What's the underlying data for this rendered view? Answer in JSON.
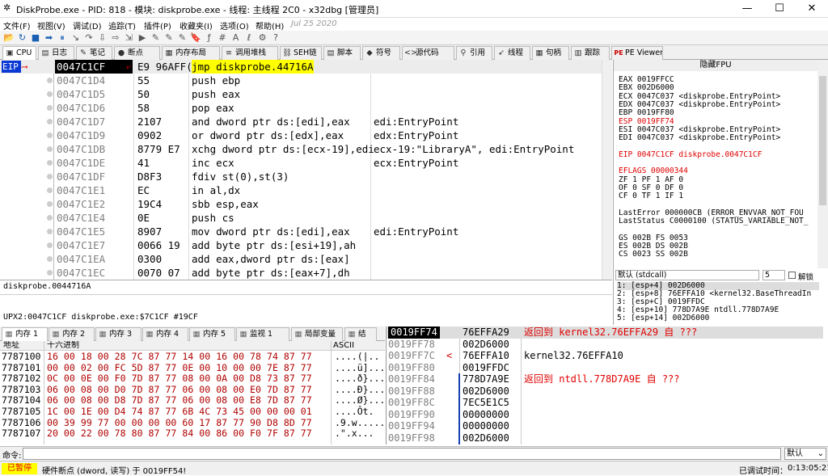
{
  "window": {
    "title": "DiskProbe.exe - PID: 818 - 模块: diskprobe.exe - 线程: 主线程 2C0 - x32dbg [管理员]",
    "minimize": "—",
    "maximize": "☐",
    "close": "✕"
  },
  "menu": [
    "文件(F)",
    "视图(V)",
    "调试(D)",
    "追踪(T)",
    "插件(P)",
    "收藏夹(I)",
    "选项(O)",
    "帮助(H)",
    "Jul 25 2020"
  ],
  "toolbar_icons": [
    "open-icon",
    "restart-icon",
    "close-icon",
    "run-icon",
    "pause-icon",
    "step-into-icon",
    "step-over-icon",
    "trace-into-icon",
    "trace-over-icon",
    "run-to-user-icon",
    "animate-icon",
    "highlight-icon",
    "comment-icon",
    "label-icon",
    "bookmark-icon",
    "function-icon",
    "hash-icon",
    "string-icon",
    "module-icon",
    "settings-icon",
    "help-icon"
  ],
  "toolbar_glyphs": [
    "📂",
    "↻",
    "■",
    "➡",
    "⏸",
    "↘",
    "↷",
    "⇩",
    "⇨",
    "⇲",
    "▶",
    "✎",
    "✎",
    "✎",
    "🔖",
    "ƒ",
    "#",
    "A",
    "ℓ",
    "⚙",
    "?"
  ],
  "tabs": [
    {
      "label": "CPU",
      "icon": "▣"
    },
    {
      "label": "日志",
      "icon": "▤"
    },
    {
      "label": "笔记",
      "icon": "✎"
    },
    {
      "label": "断点",
      "icon": "●"
    },
    {
      "label": "内存布局",
      "icon": "▦"
    },
    {
      "label": "调用堆栈",
      "icon": "≡"
    },
    {
      "label": "SEH链",
      "icon": "⛓"
    },
    {
      "label": "脚本",
      "icon": "▤"
    },
    {
      "label": "符号",
      "icon": "◆"
    },
    {
      "label": "源代码",
      "icon": "<>"
    },
    {
      "label": "引用",
      "icon": "⚲"
    },
    {
      "label": "线程",
      "icon": "➶"
    },
    {
      "label": "句柄",
      "icon": "▦"
    },
    {
      "label": "跟踪",
      "icon": "▥"
    },
    {
      "label": "PE Viewer",
      "icon": "PE"
    }
  ],
  "disasm": {
    "eip_label": "EIP",
    "rows": [
      {
        "addr": "0047C1CF",
        "bytes": "E9 96AFF(",
        "instr": "jmp diskprobe.44716A",
        "cmt": ""
      },
      {
        "addr": "0047C1D4",
        "bytes": "55",
        "instr": "push ebp",
        "cmt": ""
      },
      {
        "addr": "0047C1D5",
        "bytes": "50",
        "instr": "push eax",
        "cmt": ""
      },
      {
        "addr": "0047C1D6",
        "bytes": "58",
        "instr": "pop eax",
        "cmt": ""
      },
      {
        "addr": "0047C1D7",
        "bytes": "2107",
        "instr": "and dword ptr ds:[edi],eax",
        "cmt": "edi:EntryPoint"
      },
      {
        "addr": "0047C1D9",
        "bytes": "0902",
        "instr": "or dword ptr ds:[edx],eax",
        "cmt": "edx:EntryPoint"
      },
      {
        "addr": "0047C1DB",
        "bytes": "8779 E7",
        "instr": "xchg dword ptr ds:[ecx-19],edi",
        "cmt": "ecx-19:\"LibraryA\", edi:EntryPoint"
      },
      {
        "addr": "0047C1DE",
        "bytes": "41",
        "instr": "inc ecx",
        "cmt": "ecx:EntryPoint"
      },
      {
        "addr": "0047C1DF",
        "bytes": "D8F3",
        "instr": "fdiv st(0),st(3)",
        "cmt": ""
      },
      {
        "addr": "0047C1E1",
        "bytes": "EC",
        "instr": "in al,dx",
        "cmt": ""
      },
      {
        "addr": "0047C1E2",
        "bytes": "19C4",
        "instr": "sbb esp,eax",
        "cmt": ""
      },
      {
        "addr": "0047C1E4",
        "bytes": "0E",
        "instr": "push cs",
        "cmt": ""
      },
      {
        "addr": "0047C1E5",
        "bytes": "8907",
        "instr": "mov dword ptr ds:[edi],eax",
        "cmt": "edi:EntryPoint"
      },
      {
        "addr": "0047C1E7",
        "bytes": "0066 19",
        "instr": "add byte ptr ds:[esi+19],ah",
        "cmt": ""
      },
      {
        "addr": "0047C1EA",
        "bytes": "0300",
        "instr": "add eax,dword ptr ds:[eax]",
        "cmt": ""
      },
      {
        "addr": "0047C1EC",
        "bytes": "0070 07",
        "instr": "add byte ptr ds:[eax+7],dh",
        "cmt": ""
      }
    ]
  },
  "registers": {
    "header": "隐藏FPU",
    "lines": [
      "EAX    0019FFCC",
      "EBX    002D6000",
      "ECX    0047C037     <diskprobe.EntryPoint>",
      "EDX    0047C037     <diskprobe.EntryPoint>",
      "EBP    0019FF80",
      "ESP    0019FF74",
      "ESI    0047C037     <diskprobe.EntryPoint>",
      "EDI    0047C037     <diskprobe.EntryPoint>",
      "",
      "EIP    0047C1CF     diskprobe.0047C1CF",
      "",
      "EFLAGS   00000344",
      "ZF 1   PF 1   AF 0",
      "OF 0   SF 0   DF 0",
      "CF 0   TF 1   IF 1",
      "",
      "LastError   000000CB (ERROR_ENVVAR_NOT_FOU",
      "LastStatus  C0000100 (STATUS_VARIABLE_NOT_",
      "",
      "GS 002B   FS 0053",
      "ES 002B   DS 002B",
      "CS 0023   SS 002B"
    ],
    "red_lines": [
      5,
      9,
      11
    ]
  },
  "callconv": {
    "label": "默认 (stdcall)",
    "count": "5",
    "unlock": "解锁"
  },
  "stack_args": [
    "1: [esp+4] 002D6000",
    "2: [esp+8] 76EFFA10 <kernel32.BaseThreadIn",
    "3: [esp+C] 0019FFDC",
    "4: [esp+10] 778D7A9E ntdll.778D7A9E",
    "5: [esp+14] 002D6000"
  ],
  "info": {
    "line1": "diskprobe.0044716A",
    "line2": "UPX2:0047C1CF diskprobe.exe:$7C1CF #19CF"
  },
  "memtabs": [
    "内存 1",
    "内存 2",
    "内存 3",
    "内存 4",
    "内存 5",
    "监视 1",
    "局部变量",
    "结"
  ],
  "dump": {
    "col_addr": "地址",
    "col_hex": "十六进制",
    "col_ascii": "ASCII",
    "rows": [
      {
        "addr": "7787100",
        "hex": "16 00 18 00 28 7C 87 77 14 00 16 00 78 74 87 77",
        "ascii": "....(|.."
      },
      {
        "addr": "7787101",
        "hex": "00 00 02 00 FC 5D 87 77 0E 00 10 00 00 7E 87 77",
        "ascii": "....ü]..."
      },
      {
        "addr": "7787102",
        "hex": "0C 00 0E 00 F0 7D 87 77 08 00 0A 00 D8 73 87 77",
        "ascii": "....ð}..."
      },
      {
        "addr": "7787103",
        "hex": "06 00 08 00 D0 7D 87 77 06 00 08 00 E0 7D 87 77",
        "ascii": "....Ð}..."
      },
      {
        "addr": "7787104",
        "hex": "06 00 08 00 D8 7D 87 77 06 00 08 00 E8 7D 87 77",
        "ascii": "....Ø}..."
      },
      {
        "addr": "7787105",
        "hex": "1C 00 1E 00 D4 74 87 77 6B 4C 73 45 00 00 00 01",
        "ascii": "....Ôt."
      },
      {
        "addr": "7787106",
        "hex": "00 39 99 77 00 00 00 00 60 17 87 77 90 D8 8D 77",
        "ascii": ".9.w....."
      },
      {
        "addr": "7787107",
        "hex": "20 00 22 00 78 80 87 77 84 00 86 00 F0 7F 87 77",
        "ascii": " .\".x..."
      }
    ]
  },
  "stack": {
    "rows": [
      {
        "addr": "0019FF74",
        "val": "76EFFA29",
        "cmt": "返回到 kernel32.76EFFA29 自 ???",
        "cmt_red": true
      },
      {
        "addr": "0019FF78",
        "val": "002D6000",
        "cmt": "",
        "cmt_red": false
      },
      {
        "addr": "0019FF7C",
        "val": "76EFFA10",
        "cmt": "kernel32.76EFFA10",
        "cmt_red": false
      },
      {
        "addr": "0019FF80",
        "val": "0019FFDC",
        "cmt": "",
        "cmt_red": false
      },
      {
        "addr": "0019FF84",
        "val": "778D7A9E",
        "cmt": "返回到 ntdll.778D7A9E 自 ???",
        "cmt_red": true
      },
      {
        "addr": "0019FF88",
        "val": "002D6000",
        "cmt": "",
        "cmt_red": false
      },
      {
        "addr": "0019FF8C",
        "val": "7EC5E1C5",
        "cmt": "",
        "cmt_red": false
      },
      {
        "addr": "0019FF90",
        "val": "00000000",
        "cmt": "",
        "cmt_red": false
      },
      {
        "addr": "0019FF94",
        "val": "00000000",
        "cmt": "",
        "cmt_red": false
      },
      {
        "addr": "0019FF98",
        "val": "002D6000",
        "cmt": "",
        "cmt_red": false
      }
    ]
  },
  "command": {
    "label": "命令:",
    "value": "",
    "mode": "默认"
  },
  "status": {
    "state": "已暂停",
    "message": "硬件断点 (dword, 读写) 于 0019FF54!",
    "right": "已调试时间：",
    "time": "0:13:05:21"
  },
  "colors": {
    "accent_red": "#e00000",
    "eip_bg": "#0a39d4",
    "current_row_bg": "#000000",
    "jmp_bg": "#ffff00",
    "status_paused": "#ff0000"
  }
}
